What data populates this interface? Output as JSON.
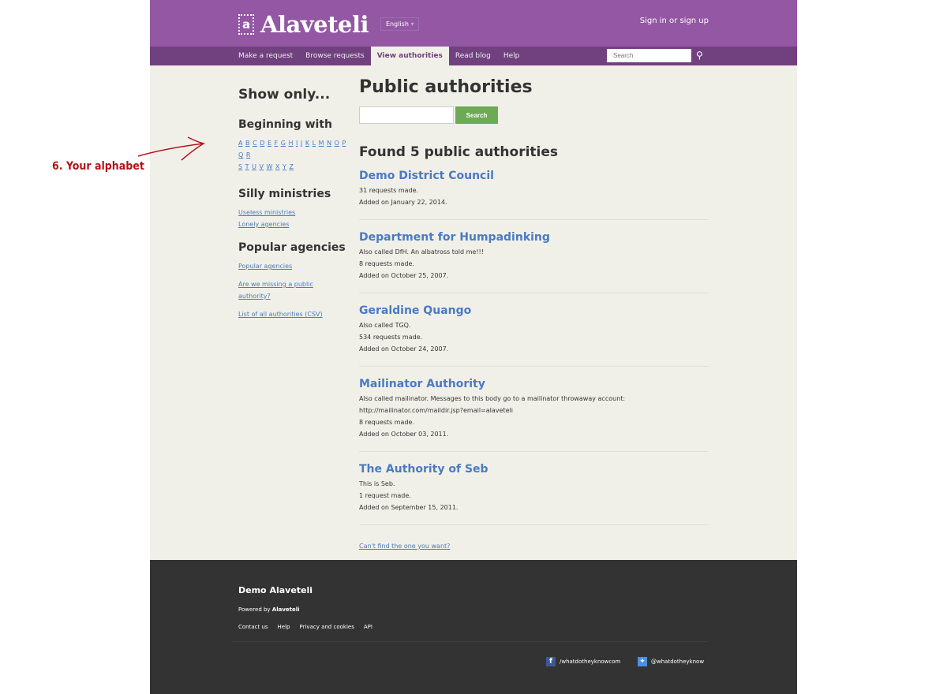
{
  "header": {
    "logo": "Alaveteli",
    "logo_mark": "a",
    "language": "English",
    "signin": "Sign in or sign up"
  },
  "nav": {
    "items": [
      "Make a request",
      "Browse requests",
      "View authorities",
      "Read blog",
      "Help"
    ],
    "active": "View authorities",
    "search_placeholder": "Search"
  },
  "sidebar": {
    "title": "Show only...",
    "beginning": "Beginning with",
    "letters_row1": [
      "A",
      "B",
      "C",
      "D",
      "E",
      "F",
      "G",
      "H",
      "I",
      "J",
      "K",
      "L",
      "M",
      "N",
      "O",
      "P",
      "Q",
      "R"
    ],
    "letters_row2": [
      "S",
      "T",
      "U",
      "V",
      "W",
      "X",
      "Y",
      "Z"
    ],
    "silly": "Silly ministries",
    "silly_links": [
      "Useless ministries",
      "Lonely agencies"
    ],
    "popular": "Popular agencies",
    "popular_links": [
      "Popular agencies",
      "Are we missing a public authority?",
      "List of all authorities (CSV)"
    ]
  },
  "main": {
    "title": "Public authorities",
    "search_button": "Search",
    "found": "Found 5 public authorities",
    "authorities": [
      {
        "name": "Demo District Council",
        "lines": [
          "31 requests made.",
          "Added on January 22, 2014."
        ]
      },
      {
        "name": "Department for Humpadinking",
        "lines": [
          "Also called DfH. An albatross told me!!!",
          "8 requests made.",
          "Added on October 25, 2007."
        ]
      },
      {
        "name": "Geraldine Quango",
        "lines": [
          "Also called TGQ.",
          "534 requests made.",
          "Added on October 24, 2007."
        ]
      },
      {
        "name": "Mailinator Authority",
        "lines": [
          "Also called mailinator. Messages to this body go to a mailinator throwaway account:",
          "http://mailinator.com/maildir.jsp?email=alaveteli",
          "8 requests made.",
          "Added on October 03, 2011."
        ]
      },
      {
        "name": "The Authority of Seb",
        "lines": [
          "This is Seb.",
          "1 request made.",
          "Added on September 15, 2011."
        ]
      }
    ],
    "cant_find": "Can't find the one you want?"
  },
  "footer": {
    "name": "Demo Alaveteli",
    "powered_prefix": "Powered by ",
    "powered_name": "Alaveteli",
    "links": [
      "Contact us",
      "Help",
      "Privacy and cookies",
      "API"
    ],
    "facebook": "/whatdotheyknowcom",
    "twitter": "@whatdotheyknow"
  },
  "annotation": "6. Your alphabet",
  "colors": {
    "header": "#9357a3",
    "nav": "#71407f",
    "link": "#4a7ac2",
    "search_button": "#6daa54",
    "annotation": "#b3141b"
  }
}
